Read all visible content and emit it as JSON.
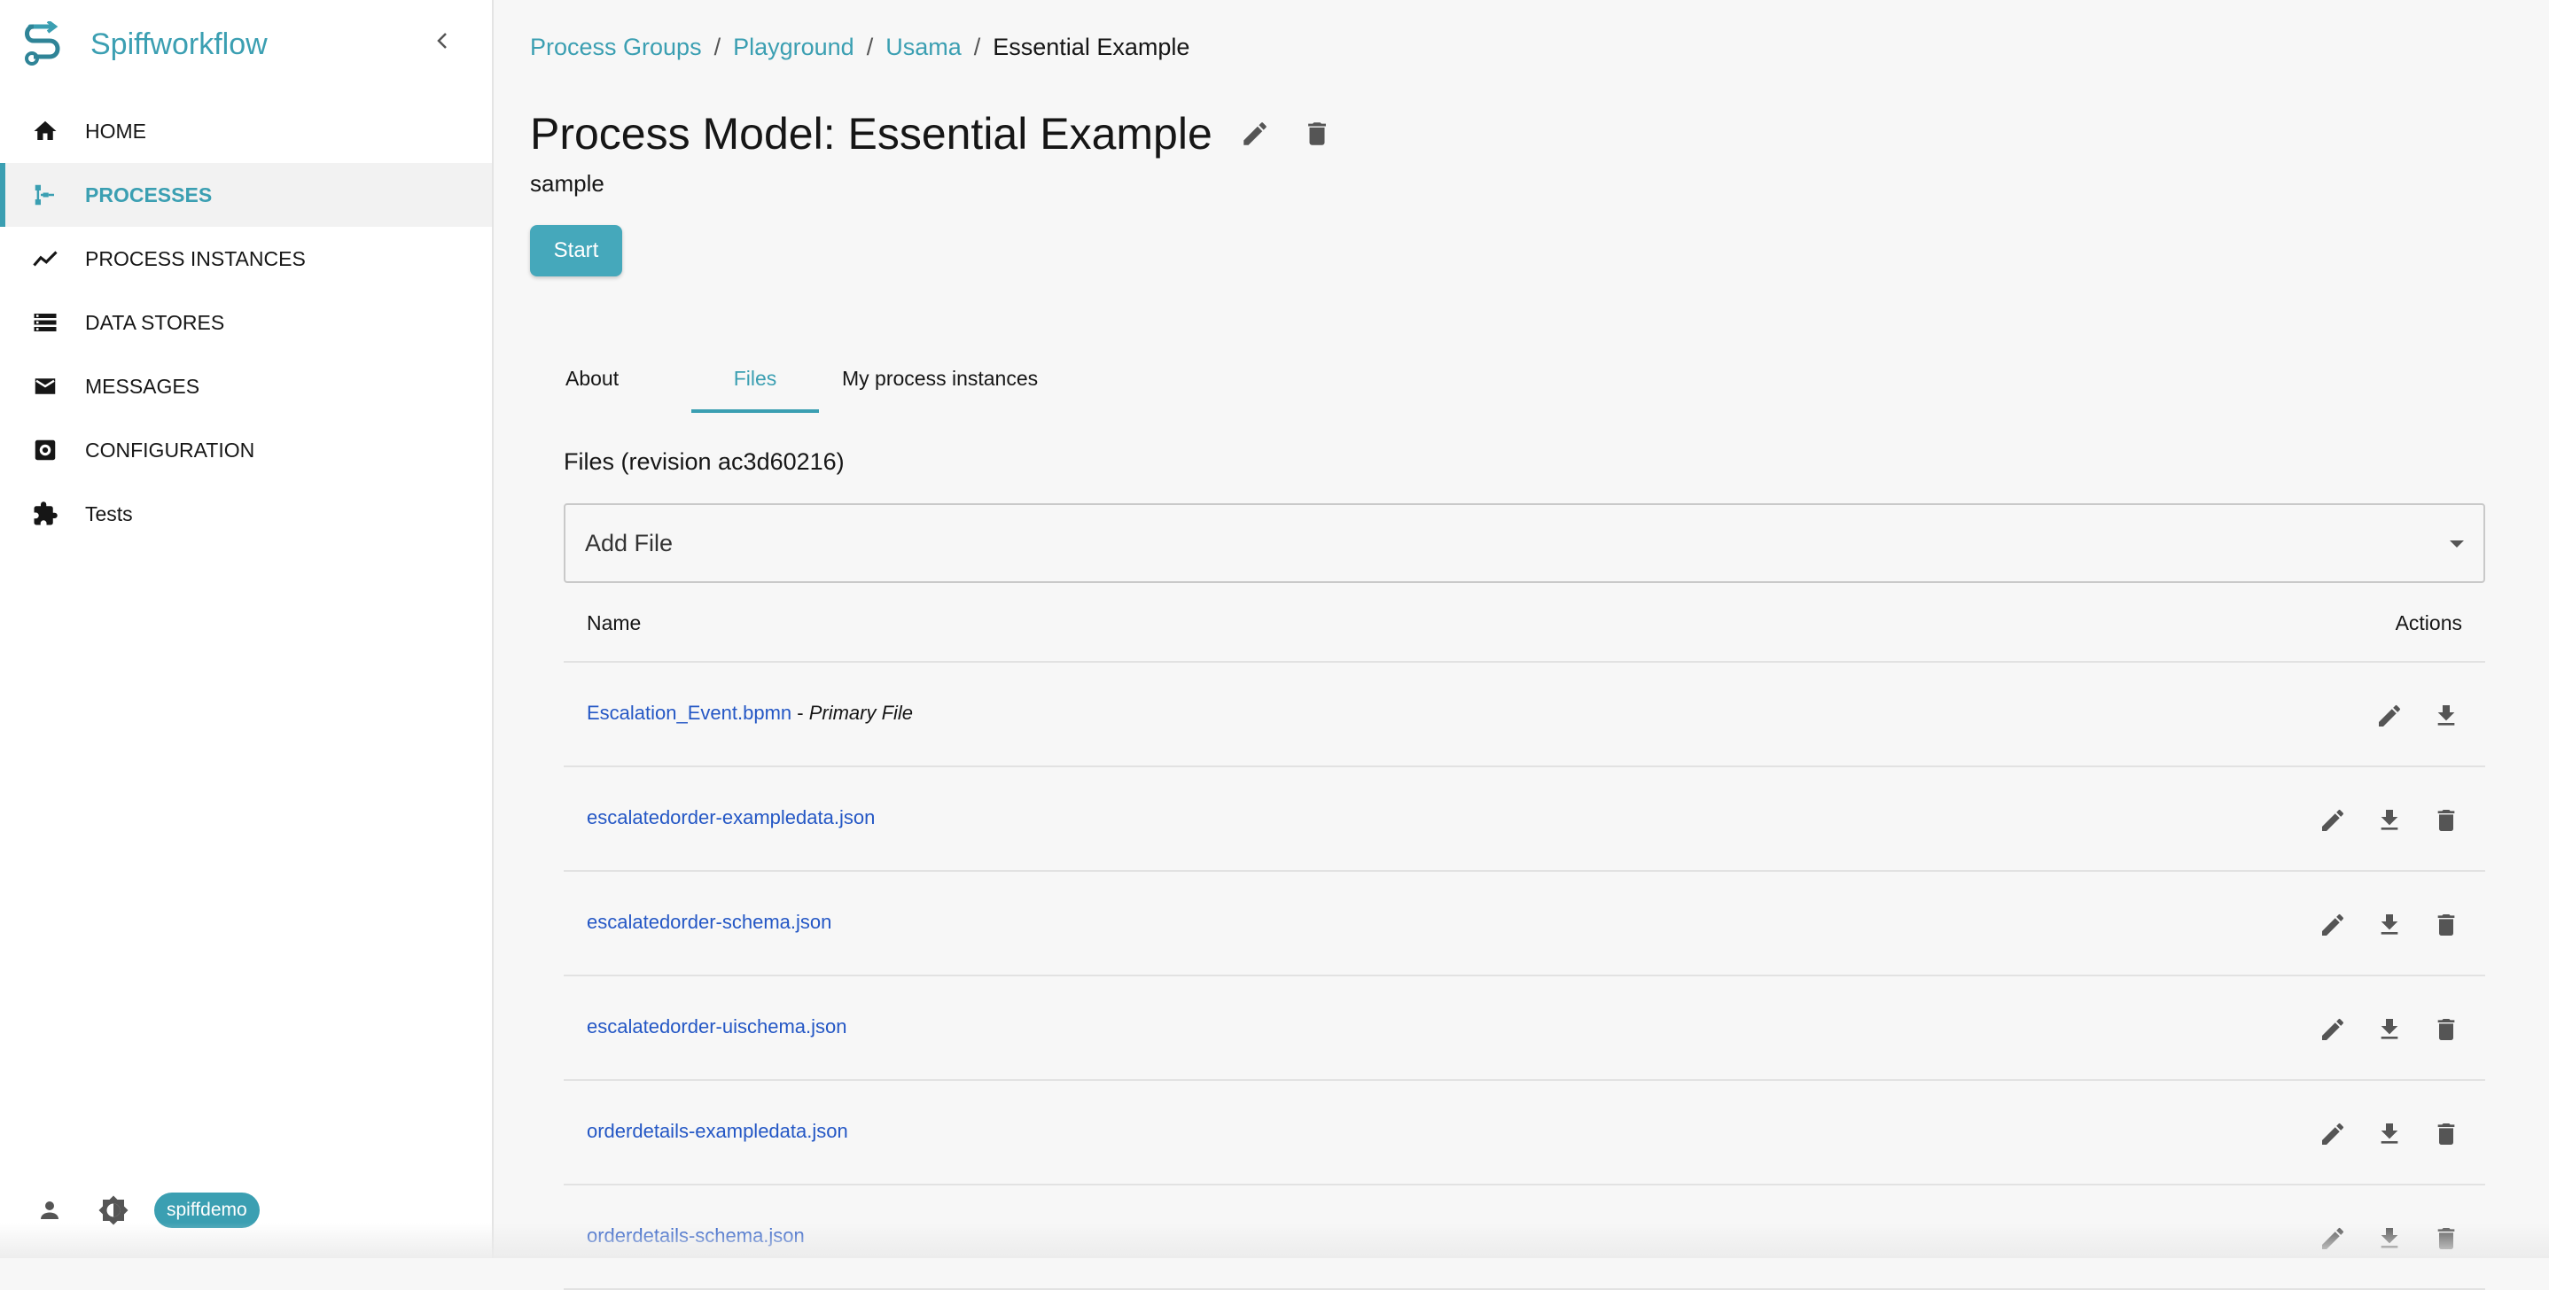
{
  "app": {
    "name": "Spiffworkflow"
  },
  "sidebar": {
    "items": [
      {
        "label": "HOME",
        "icon": "home-icon"
      },
      {
        "label": "PROCESSES",
        "icon": "processes-icon",
        "active": true
      },
      {
        "label": "PROCESS INSTANCES",
        "icon": "trending-icon"
      },
      {
        "label": "DATA STORES",
        "icon": "storage-icon"
      },
      {
        "label": "MESSAGES",
        "icon": "mail-icon"
      },
      {
        "label": "CONFIGURATION",
        "icon": "settings-icon"
      },
      {
        "label": "Tests",
        "icon": "puzzle-icon"
      }
    ],
    "footer": {
      "username": "spiffdemo"
    }
  },
  "breadcrumb": {
    "items": [
      "Process Groups",
      "Playground",
      "Usama"
    ],
    "current": "Essential Example",
    "separator": "/"
  },
  "page": {
    "title": "Process Model: Essential Example",
    "description": "sample",
    "start_label": "Start"
  },
  "tabs": [
    {
      "label": "About"
    },
    {
      "label": "Files",
      "active": true
    },
    {
      "label": "My process instances"
    }
  ],
  "files": {
    "heading": "Files (revision ac3d60216)",
    "add_file_label": "Add File",
    "columns": {
      "name": "Name",
      "actions": "Actions"
    },
    "primary_suffix": " - ",
    "primary_label": "Primary File",
    "rows": [
      {
        "name": "Escalation_Event.bpmn",
        "primary": true
      },
      {
        "name": "escalatedorder-exampledata.json"
      },
      {
        "name": "escalatedorder-schema.json"
      },
      {
        "name": "escalatedorder-uischema.json"
      },
      {
        "name": "orderdetails-exampledata.json"
      },
      {
        "name": "orderdetails-schema.json"
      }
    ]
  },
  "colors": {
    "accent": "#3b9fb2",
    "link": "#2457c5",
    "icon": "#555555"
  }
}
